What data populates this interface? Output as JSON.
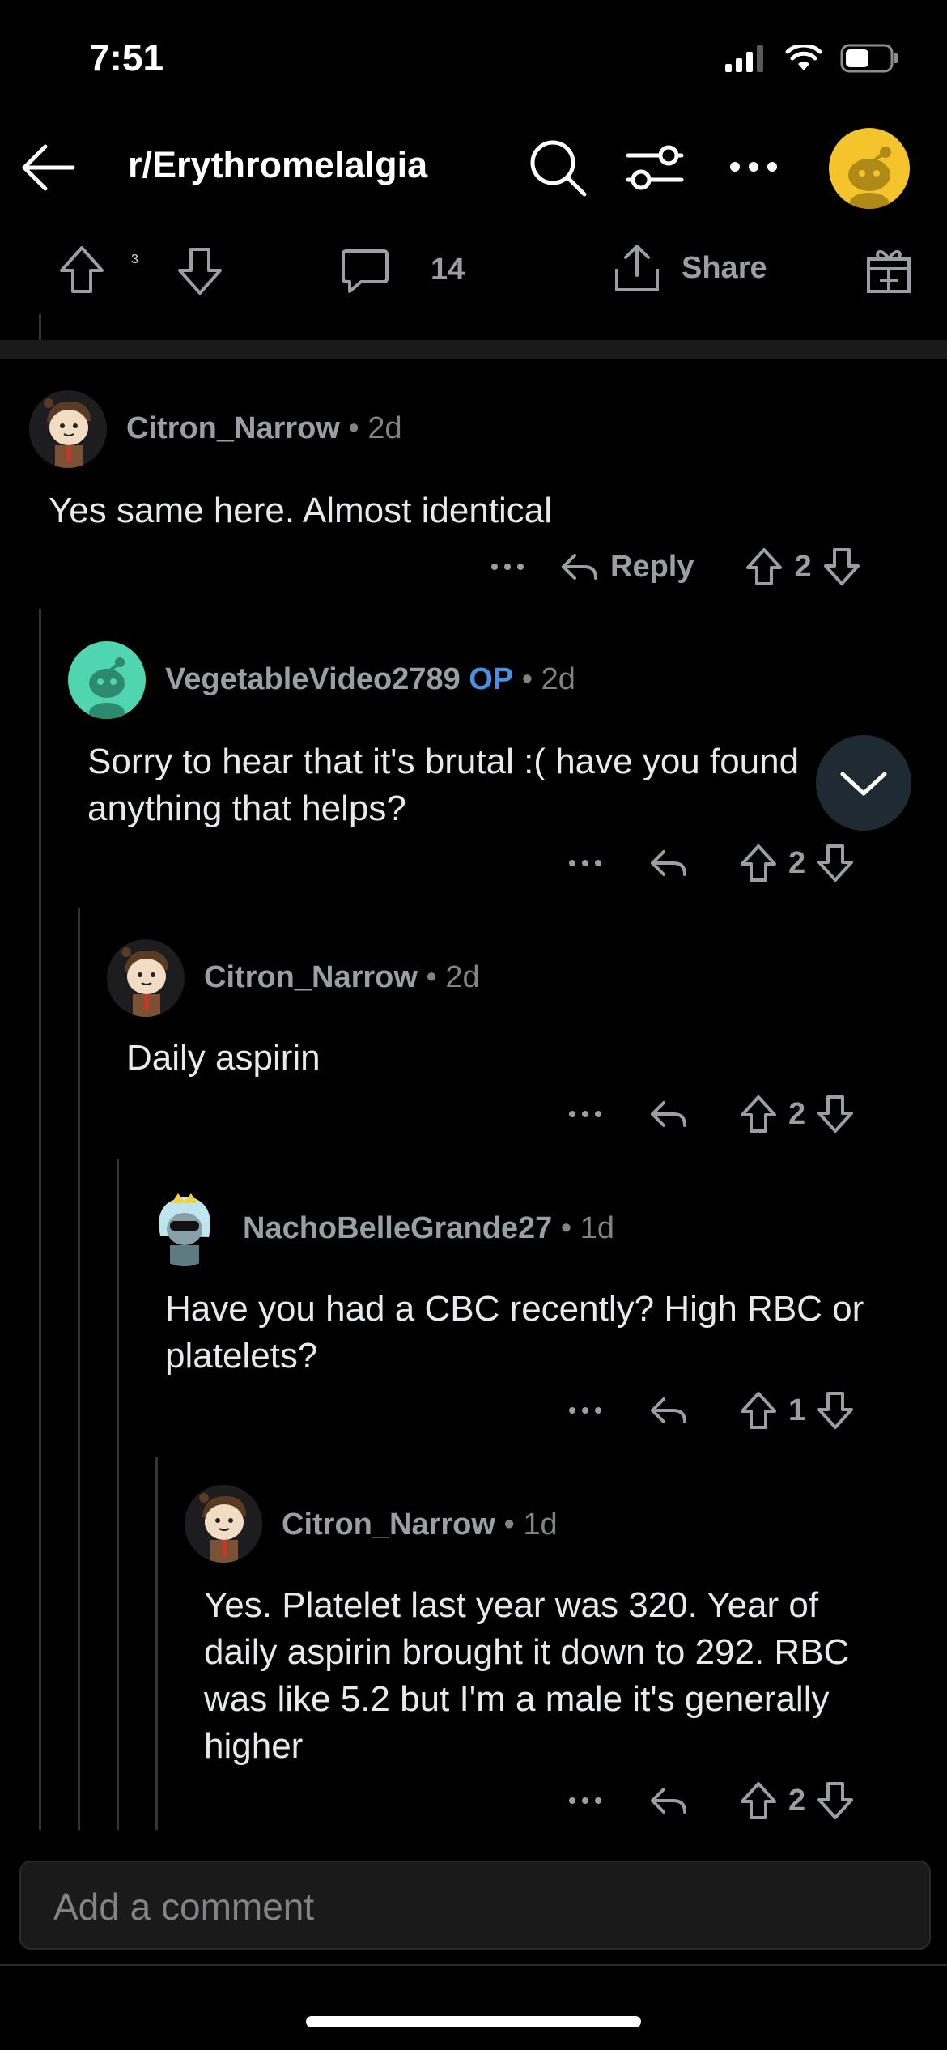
{
  "status": {
    "time": "7:51"
  },
  "header": {
    "title": "r/Erythromelalgia"
  },
  "post_actions": {
    "upvotes": "3",
    "comments": "14",
    "share_label": "Share"
  },
  "comments": [
    {
      "user": "Citron_Narrow",
      "age": "2d",
      "body": "Yes same here. Almost identical",
      "reply_label": "Reply",
      "votes": "2"
    },
    {
      "user": "VegetableVideo2789",
      "op_label": "OP",
      "age": "2d",
      "body": "Sorry to hear that it's brutal :( have you found anything that helps?",
      "votes": "2"
    },
    {
      "user": "Citron_Narrow",
      "age": "2d",
      "body": "Daily aspirin",
      "votes": "2"
    },
    {
      "user": "NachoBelleGrande27",
      "age": "1d",
      "body": "Have you had a CBC recently? High RBC or platelets?",
      "votes": "1"
    },
    {
      "user": "Citron_Narrow",
      "age": "1d",
      "body": "Yes. Platelet last year was 320. Year of daily aspirin brought it down to 292. RBC was like 5.2 but I'm a male it's generally higher",
      "votes": "2"
    }
  ],
  "composer": {
    "placeholder": "Add a comment"
  },
  "icons": [
    "back-arrow-icon",
    "search-icon",
    "filter-icon",
    "more-icon",
    "avatar",
    "upvote-icon",
    "downvote-icon",
    "comment-icon",
    "share-icon",
    "award-icon",
    "reply-icon",
    "chevron-down-icon"
  ]
}
